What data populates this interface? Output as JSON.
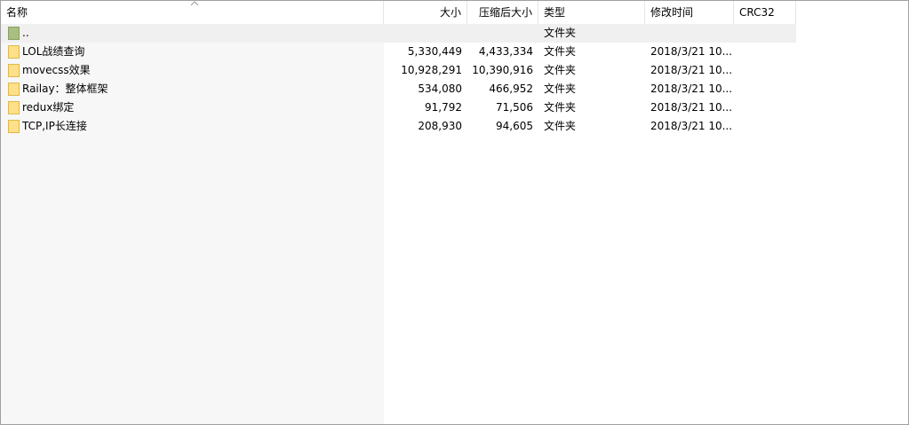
{
  "columns": {
    "name": "名称",
    "size": "大小",
    "packed": "压缩后大小",
    "type": "类型",
    "modified": "修改时间",
    "crc": "CRC32"
  },
  "parent_row": {
    "name": "..",
    "type": "文件夹"
  },
  "rows": [
    {
      "name": "LOL战绩查询",
      "size": "5,330,449",
      "packed": "4,433,334",
      "type": "文件夹",
      "modified": "2018/3/21 10..."
    },
    {
      "name": "movecss效果",
      "size": "10,928,291",
      "packed": "10,390,916",
      "type": "文件夹",
      "modified": "2018/3/21 10..."
    },
    {
      "name": "Railay：整体框架",
      "size": "534,080",
      "packed": "466,952",
      "type": "文件夹",
      "modified": "2018/3/21 10..."
    },
    {
      "name": "redux绑定",
      "size": "91,792",
      "packed": "71,506",
      "type": "文件夹",
      "modified": "2018/3/21 10..."
    },
    {
      "name": "TCP,IP长连接",
      "size": "208,930",
      "packed": "94,605",
      "type": "文件夹",
      "modified": "2018/3/21 10..."
    }
  ],
  "colors": {
    "folder_fill": "#ffe08a",
    "folder_edge": "#e0b84a",
    "parent_icon_fill": "#a9be82",
    "name_column_bg": "#f7f7f7",
    "selected_row_bg": "#f0f0f0"
  },
  "icons": {
    "folder": "folder-icon",
    "parent": "parent-folder-icon",
    "sort": "sort-ascending-icon"
  }
}
